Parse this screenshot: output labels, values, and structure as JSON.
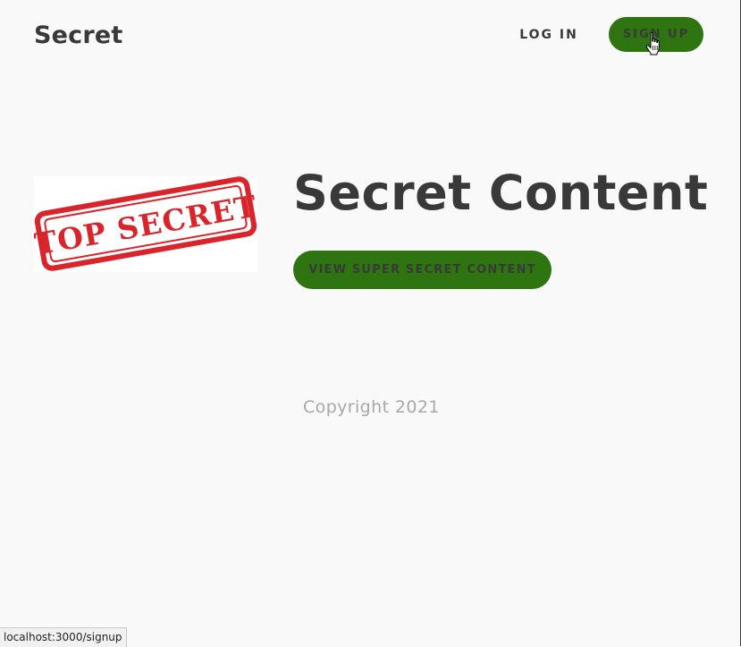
{
  "nav": {
    "brand": "Secret",
    "login_label": "LOG IN",
    "signup_label": "SIGN UP"
  },
  "hero": {
    "image_text": "TOP SECRET",
    "title": "Secret Content",
    "cta_label": "VIEW SUPER SECRET CONTENT"
  },
  "footer": {
    "copyright": "Copyright 2021"
  },
  "status_bar": {
    "url": "localhost:3000/signup"
  },
  "colors": {
    "accent": "#2e7511",
    "text": "#393939",
    "muted": "#a8a8a8",
    "background": "#f9f9f9",
    "stamp": "#d8242a"
  },
  "icons": {
    "cursor": "hand-pointer-cursor-icon"
  }
}
